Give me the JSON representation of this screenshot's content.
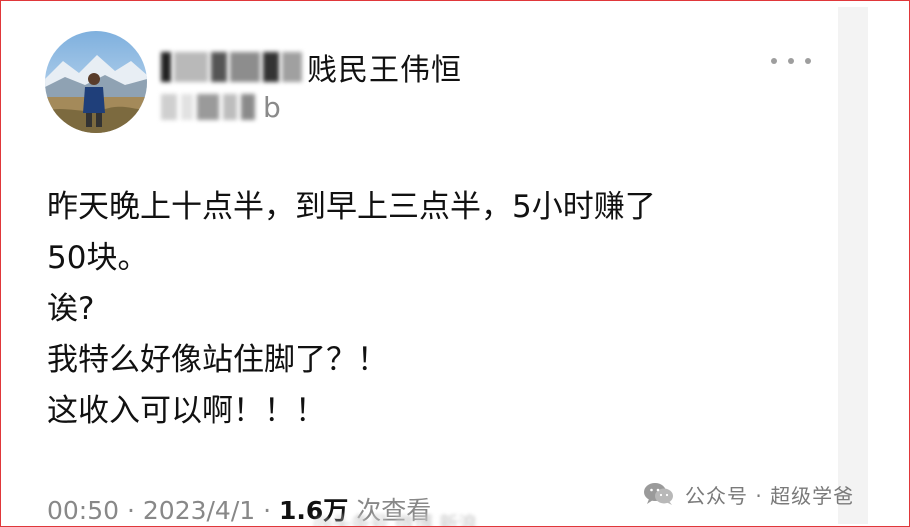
{
  "post": {
    "username_visible": "贱民王伟恒",
    "sub_suffix": "b",
    "lines": [
      "昨天晚上十点半，到早上三点半，5小时赚了",
      "50块。",
      "诶?",
      "我特么好像站住脚了？！",
      "这收入可以啊！！！"
    ],
    "meta": {
      "time": "00:50",
      "separator": " · ",
      "date": "2023/4/1",
      "separator2": " · ",
      "views_number": "1.6万",
      "views_suffix": " 次查看"
    }
  },
  "watermark": {
    "source_text": "@头条号 微博 新浪"
  },
  "wechat": {
    "label": "公众号 · 超级学爸",
    "icon": "wechat-icon"
  },
  "colors": {
    "frame_border": "#e0373a",
    "text": "#111111",
    "muted": "#888888",
    "strip": "#f3f3f3"
  }
}
